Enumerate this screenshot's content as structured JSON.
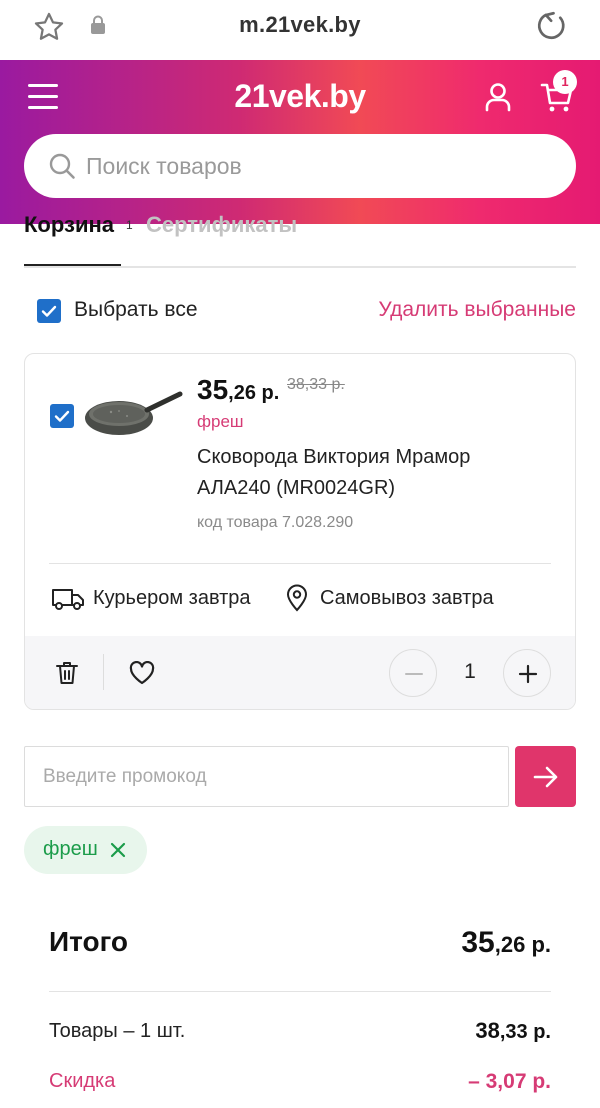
{
  "browser": {
    "url": "m.21vek.by",
    "icons": [
      "star-icon",
      "lock-icon",
      "reload-icon"
    ]
  },
  "header": {
    "logo": "21vek.by",
    "cart_count": "1",
    "search_placeholder": "Поиск товаров",
    "gradient_colors": [
      "#9a1aa0",
      "#f14a55",
      "#e51a72"
    ]
  },
  "tabs": {
    "cart_label": "Корзина",
    "cart_superscript": "1",
    "certificates_label": "Сертификаты"
  },
  "selection": {
    "select_all_label": "Выбрать все",
    "select_all_checked": true,
    "delete_selected_label": "Удалить выбранные"
  },
  "product": {
    "checked": true,
    "price_int": "35",
    "price_dec": ",26 р.",
    "old_price": "38,33 р.",
    "promo_tag": "фреш",
    "name": "Сковорода Виктория Мрамор АЛА240 (MR0024GR)",
    "code": "код товара 7.028.290",
    "delivery_courier": "Курьером завтра",
    "delivery_pickup": "Самовывоз завтра",
    "quantity": "1"
  },
  "promo": {
    "placeholder": "Введите промокод",
    "applied_chip": "фреш"
  },
  "totals": {
    "total_label": "Итого",
    "total_int": "35",
    "total_dec": ",26 р.",
    "goods_label": "Товары – 1 шт.",
    "goods_int": "38",
    "goods_dec": ",33 р.",
    "discount_label": "Скидка",
    "discount_value": "– 3,07 р."
  },
  "colors": {
    "accent_pink": "#d63b75",
    "checkbox_blue": "#1f6fc9",
    "promo_green": "#1b9c4a",
    "submit_button": "#e0356b"
  }
}
